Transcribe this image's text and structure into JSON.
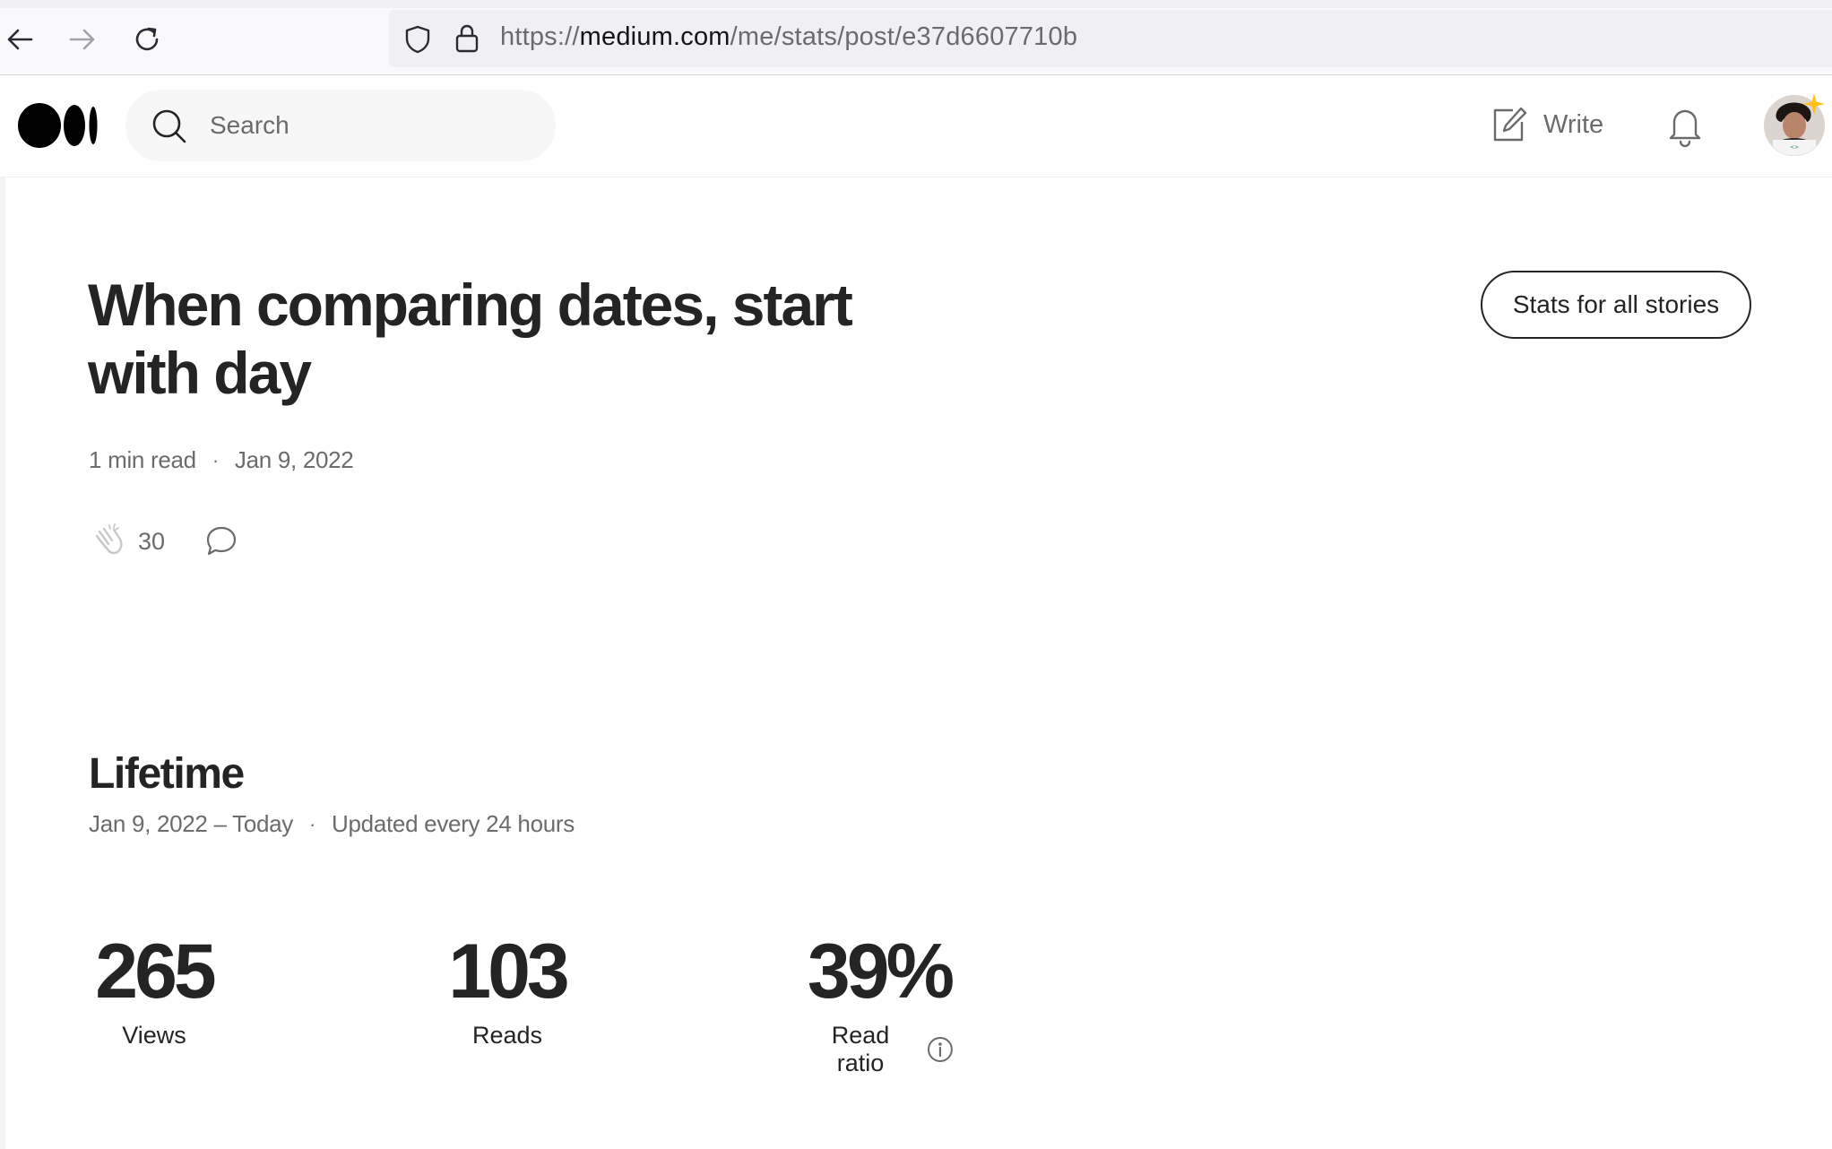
{
  "browser": {
    "url_scheme": "https://",
    "url_host": "medium.com",
    "url_path": "/me/stats/post/e37d6607710b"
  },
  "header": {
    "search_placeholder": "Search",
    "write_label": "Write"
  },
  "story": {
    "title": "When comparing dates, start with day",
    "read_time": "1 min read",
    "separator": "·",
    "published": "Jan 9, 2022",
    "claps": "30",
    "stats_all_button": "Stats for all stories"
  },
  "lifetime": {
    "title": "Lifetime",
    "range": "Jan 9, 2022 – Today",
    "separator": "·",
    "update_note": "Updated every 24 hours",
    "stats": {
      "views_value": "265",
      "views_label": "Views",
      "reads_value": "103",
      "reads_label": "Reads",
      "ratio_value": "39%",
      "ratio_label": "Read ratio"
    }
  },
  "colors": {
    "text_primary": "#242424",
    "text_secondary": "#6b6b6b",
    "search_bg": "#f7f7f7"
  }
}
